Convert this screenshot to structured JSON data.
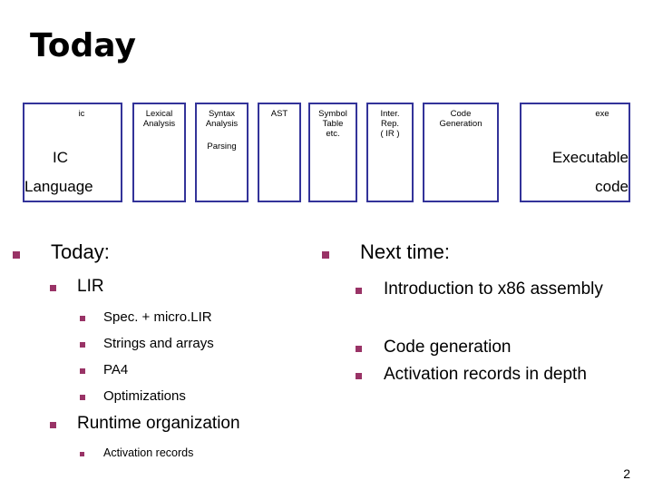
{
  "slide": {
    "title": "Today",
    "page_number": "2"
  },
  "diagram": {
    "source_label": "ic",
    "source_big_1": "IC",
    "source_big_2": "Language",
    "stages": [
      {
        "label": "Lexical\nAnalysis"
      },
      {
        "label": "Syntax\nAnalysis"
      },
      {
        "label": "AST"
      },
      {
        "label": "Symbol\nTable\netc."
      },
      {
        "label": "Inter.\nRep.\n( IR )"
      },
      {
        "label": "Code\nGeneration"
      }
    ],
    "parsing_label": "Parsing",
    "output_label": "exe",
    "output_big_1": "Executable",
    "output_big_2": "code"
  },
  "left_column": {
    "heading": "Today:",
    "sub1": "LIR",
    "sub1_items": [
      "Spec. + micro.LIR",
      "Strings and arrays",
      "PA4",
      "Optimizations"
    ],
    "sub2": "Runtime organization",
    "sub2_items": [
      "Activation records"
    ]
  },
  "right_column": {
    "heading": "Next time:",
    "items": [
      "Introduction to x86 assembly",
      "Code generation",
      "Activation records in depth"
    ]
  },
  "colors": {
    "box_border": "#333399",
    "bullet": "#993366"
  }
}
